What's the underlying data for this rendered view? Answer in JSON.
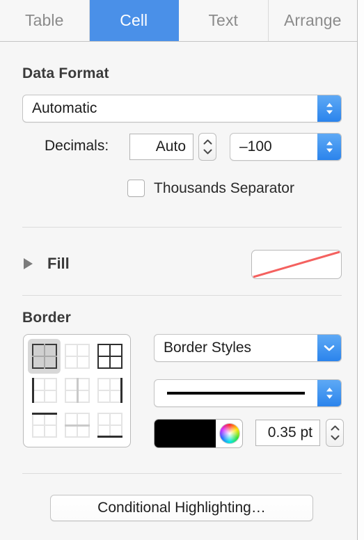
{
  "tabs": [
    {
      "label": "Table",
      "selected": false
    },
    {
      "label": "Cell",
      "selected": true
    },
    {
      "label": "Text",
      "selected": false
    },
    {
      "label": "Arrange",
      "selected": false
    }
  ],
  "data_format": {
    "title": "Data Format",
    "format_value": "Automatic",
    "decimals_label": "Decimals:",
    "decimals_value": "Auto",
    "negative_style_value": "–100",
    "thousands_separator_label": "Thousands Separator",
    "thousands_separator_checked": false
  },
  "fill": {
    "label": "Fill",
    "expanded": false,
    "swatch": "none",
    "swatch_slash_color": "#f4615f"
  },
  "border": {
    "title": "Border",
    "matrix": [
      {
        "name": "all-borders",
        "pattern": "all",
        "selected": true
      },
      {
        "name": "no-borders",
        "pattern": "none",
        "selected": false
      },
      {
        "name": "outline-and-inner",
        "pattern": "all",
        "selected": false
      },
      {
        "name": "left-edge",
        "pattern": "left",
        "selected": false
      },
      {
        "name": "inner-vertical",
        "pattern": "vmid",
        "selected": false
      },
      {
        "name": "right-edge",
        "pattern": "right",
        "selected": false
      },
      {
        "name": "top-edge",
        "pattern": "top",
        "selected": false
      },
      {
        "name": "inner-horizontal",
        "pattern": "hmid",
        "selected": false
      },
      {
        "name": "bottom-edge",
        "pattern": "bottom",
        "selected": false
      }
    ],
    "styles_popup_value": "Border Styles",
    "line_style_value": "solid",
    "color_value": "#000000",
    "width_value": "0.35 pt"
  },
  "footer": {
    "conditional_highlighting_label": "Conditional Highlighting…"
  },
  "colors": {
    "accent_blue": "#4a90e8",
    "panel_bg": "#f6f6f6",
    "text": "#1d1d1d"
  }
}
